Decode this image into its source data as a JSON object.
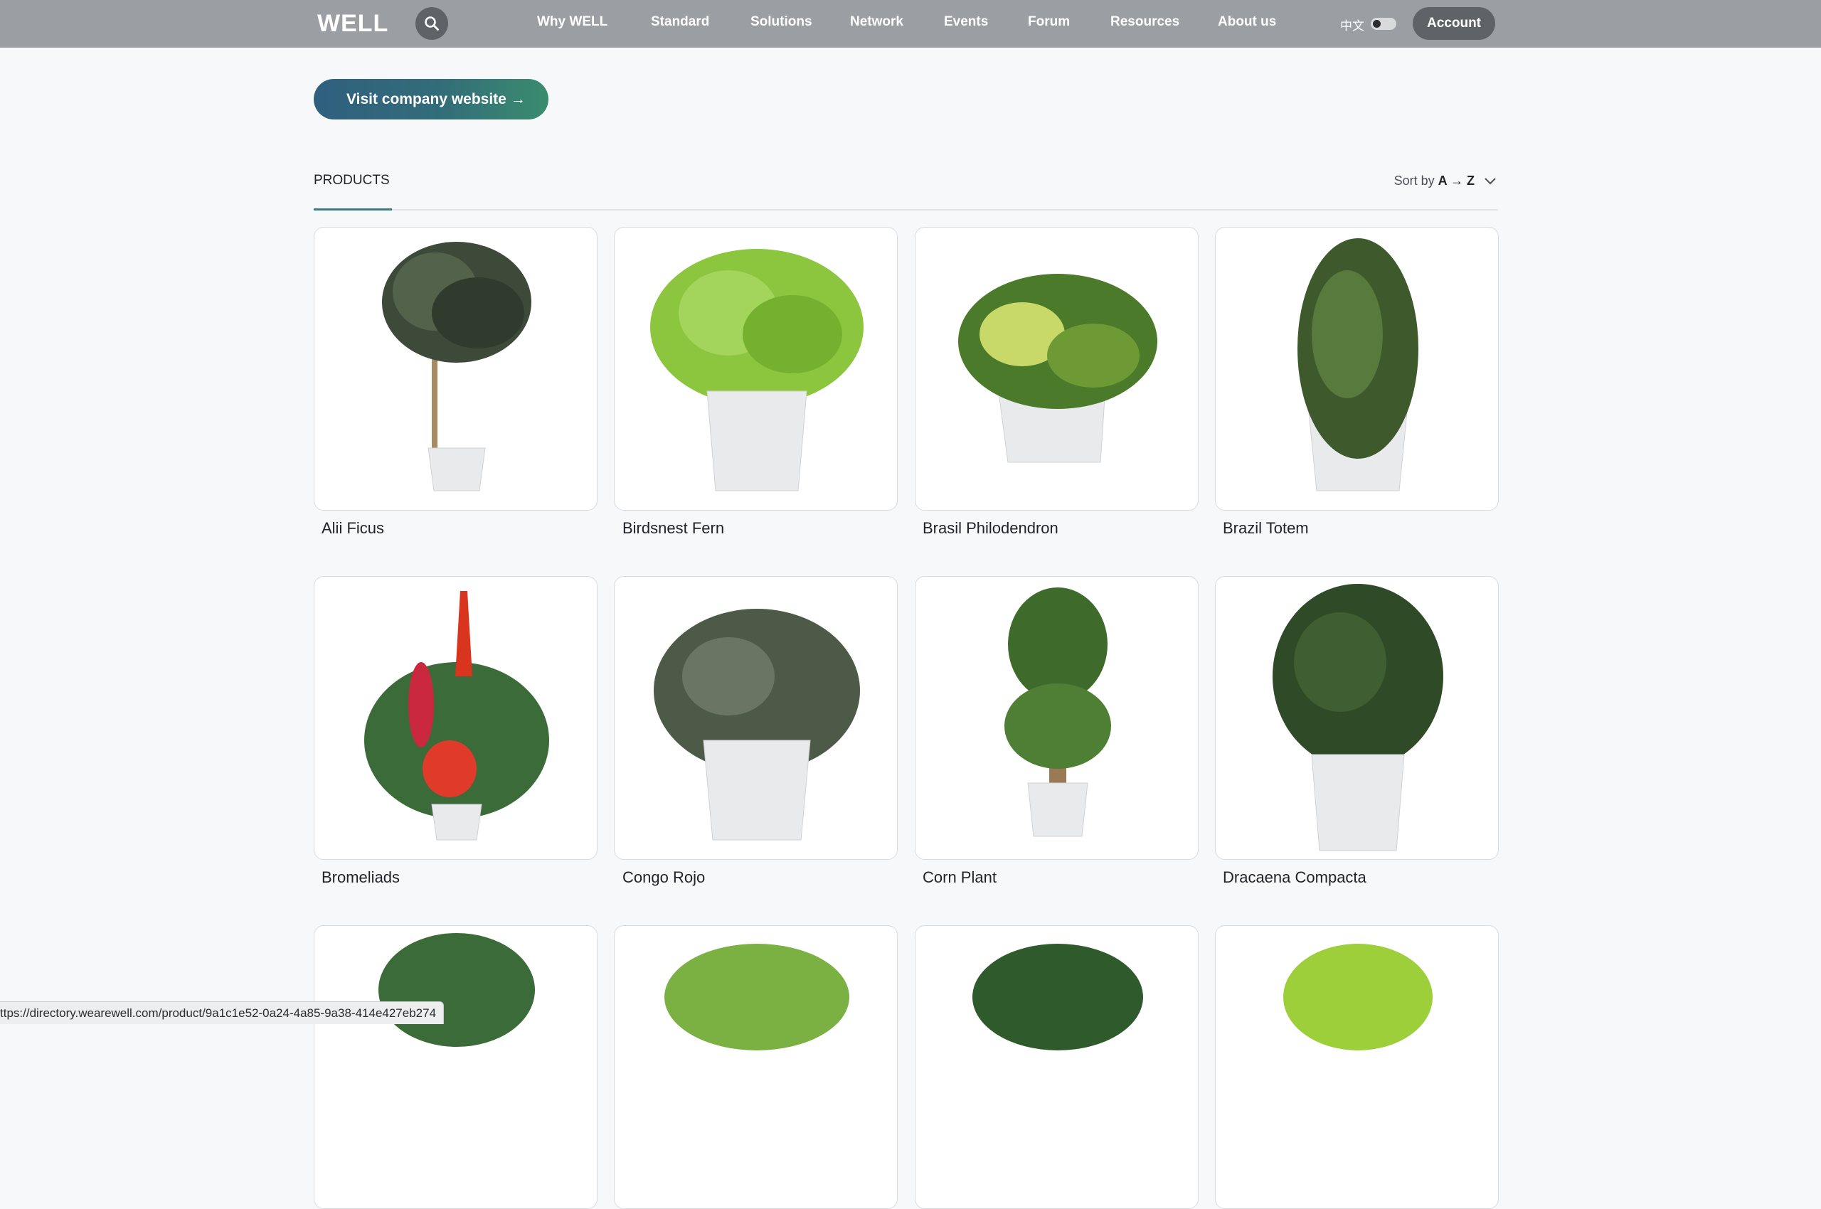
{
  "header": {
    "logo": "WELL",
    "nav": [
      "Why WELL",
      "Standard",
      "Solutions",
      "Network",
      "Events",
      "Forum",
      "Resources",
      "About us"
    ],
    "language": "中文",
    "account_label": "Account"
  },
  "visit_button": "Visit company website →",
  "products_tab": "PRODUCTS",
  "sort": {
    "prefix": "Sort by",
    "value": "A → Z"
  },
  "products": [
    "Alii Ficus",
    "Birdsnest Fern",
    "Brasil Philodendron",
    "Brazil Totem",
    "Bromeliads",
    "Congo Rojo",
    "Corn Plant",
    "Dracaena Compacta"
  ],
  "status_url": "ttps://directory.wearewell.com/product/9a1c1e52-0a24-4a85-9a38-414e427eb274",
  "colors": {
    "header_bg": "#9b9ea3",
    "button_gradient_start": "#2f5f7f",
    "button_gradient_end": "#3a8c6e",
    "tab_underline": "#3d7a85"
  },
  "icons": [
    "search-icon",
    "chevron-down-icon",
    "plant-image"
  ]
}
